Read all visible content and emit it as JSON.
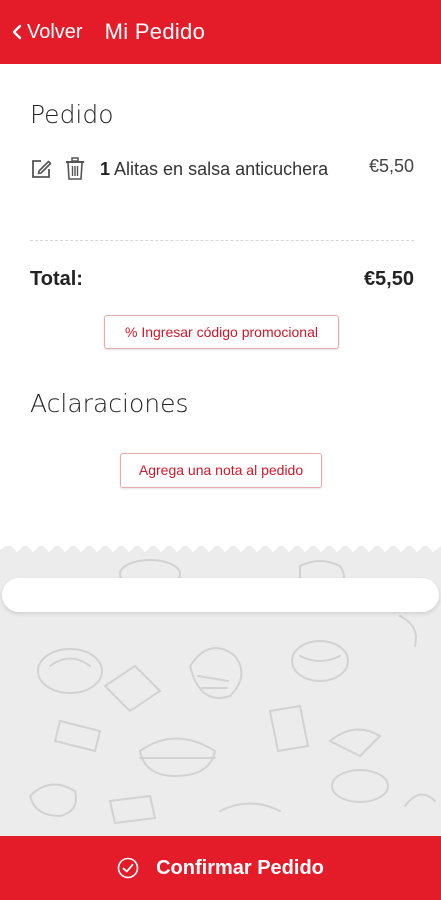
{
  "header": {
    "back_label": "Volver",
    "title": "Mi Pedido"
  },
  "order": {
    "section_title": "Pedido",
    "items": [
      {
        "quantity": "1",
        "name": "Alitas en salsa anticuchera",
        "price": "€5,50"
      }
    ],
    "total_label": "Total:",
    "total_value": "€5,50",
    "promo_button_label": "% Ingresar código promocional"
  },
  "notes": {
    "section_title": "Aclaraciones",
    "add_note_label": "Agrega una nota al pedido"
  },
  "footer": {
    "confirm_label": "Confirmar Pedido"
  },
  "colors": {
    "brand_red": "#e41c2a",
    "button_text_red": "#d0162a"
  },
  "icons": [
    "chevron-left-icon",
    "edit-icon",
    "trash-icon",
    "check-circle-icon"
  ]
}
